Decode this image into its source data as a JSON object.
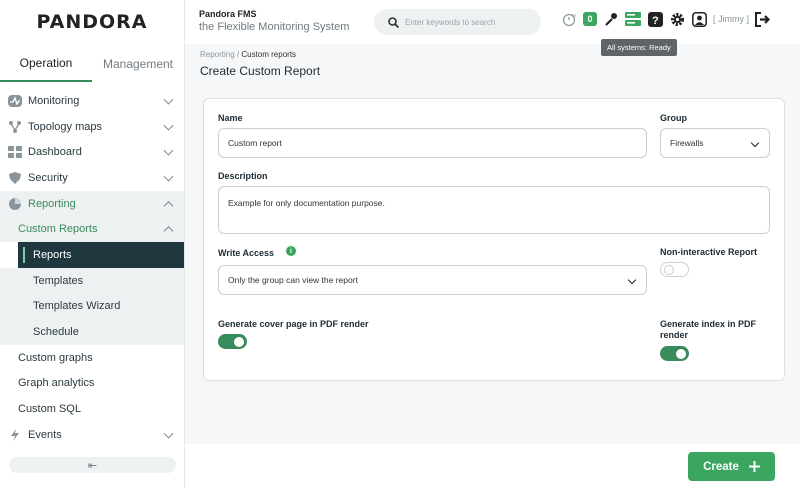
{
  "sidebar": {
    "logo": "PANDORA",
    "tabs": [
      {
        "label": "Operation"
      },
      {
        "label": "Management"
      }
    ],
    "items": {
      "monitoring": "Monitoring",
      "topology": "Topology maps",
      "dashboard": "Dashboard",
      "security": "Security",
      "reporting": "Reporting",
      "custom_reports": "Custom Reports",
      "reports": "Reports",
      "templates": "Templates",
      "templates_wizard": "Templates Wizard",
      "schedule": "Schedule",
      "custom_graphs": "Custom graphs",
      "graph_analytics": "Graph analytics",
      "custom_sql": "Custom SQL",
      "events": "Events"
    }
  },
  "header": {
    "brand_title": "Pandora FMS",
    "brand_subtitle": "the Flexible Monitoring System",
    "search_placeholder": "Enter keywords to search",
    "badge_count": "0",
    "user_label": "[ Jimmy ]",
    "tooltip": "All systems: Ready"
  },
  "breadcrumb": {
    "parent": "Reporting",
    "separator": " / ",
    "current": "Custom reports"
  },
  "page_title": "Create Custom Report",
  "form": {
    "name_label": "Name",
    "name_value": "Custom report",
    "group_label": "Group",
    "group_value": "Firewalls",
    "description_label": "Description",
    "description_value": "Example for only documentation purpose.",
    "write_access_label": "Write Access",
    "write_access_value": "Only the group can view the report",
    "non_interactive_label": "Non-interactive Report",
    "non_interactive_on": false,
    "cover_page_label": "Generate cover page in PDF render",
    "cover_page_on": true,
    "index_label_line1": "Generate index in PDF",
    "index_label_line2": "render",
    "index_on": true
  },
  "footer": {
    "create_label": "Create"
  },
  "colors": {
    "accent": "#3aa660",
    "dark": "#1f3840",
    "toggle_on": "#3a8b5c"
  }
}
